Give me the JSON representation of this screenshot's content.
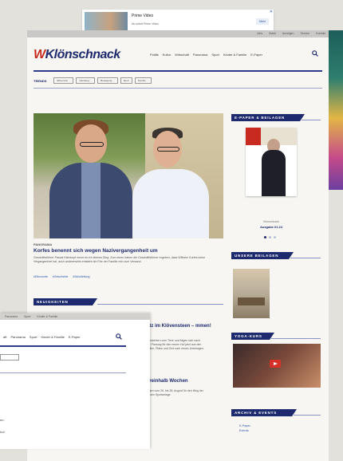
{
  "ad": {
    "title": "Prime Video",
    "subtitle": "Ab sofort Prime Video",
    "button": "Mehr",
    "close": "✕"
  },
  "topbar": [
    "Jobs",
    "Markt",
    "Anzeigen",
    "Service",
    "Kontakt"
  ],
  "logo": {
    "w": "W",
    "text": "Klönschnack"
  },
  "menu": [
    "Politik",
    "Kultur",
    "Wirtschaft",
    "Panorama",
    "Sport",
    "Kinder & Familie",
    "E-Paper"
  ],
  "trends": {
    "label": "TRENDS",
    "chips": [
      "Elbvororte ...",
      "Hamburg ...",
      "Bewegung ...",
      "Sport",
      "Familie ..."
    ]
  },
  "hero": {
    "kicker": "PANORAMA",
    "headline": "Korfes benennt sich wegen Naziver­gangenheit um",
    "teaser": "Geschäftsführer Pascal Kleinkopf nennt es ein kleines Ding: Zum einen haben die Geschäftsführer ergeben, dass Wilhelm Korfes keine Vergangenheit hat, auch andererseits entsteht die Ehe der Familie rein zum Versand.",
    "tags": [
      "#Elbvororte",
      "#Geschichte",
      "#Schulleitung"
    ]
  },
  "sections": {
    "epaper": "E-PAPER & BEILAGEN",
    "beilagen": "UNSERE BEILAGEN",
    "neuigkeiten": "NEUIGKEITEN",
    "yoga": "YOGA-KURS",
    "archiv": "ARCHIV & EVENTS"
  },
  "epaper": {
    "caption_small": "Klönschnack",
    "caption_issue": "Ausgabe 01.24"
  },
  "mid": {
    "title1": "atz im Klövensteen – mmen!",
    "text1": "wandertern vom Tiere und folgen sich nach die Planung für den neuen Hof jetzt aus den Teilen, Pläne und Zeit noch neues Unterlagen.",
    "title2": "ereinhalb Wochen",
    "text2": "ingen vom 26. bis 28. August für den Weg der neuen Sportanlage."
  },
  "archive": [
    "E-Paper",
    "Events"
  ],
  "overlay": {
    "topbar": [
      "Panorama",
      "Sport",
      "Kinder & Familie"
    ],
    "menu": [
      "aft",
      "Panorama",
      "Sport",
      "Kinder & Familie",
      "E-Paper"
    ],
    "fragments": [
      "en:",
      "hof"
    ]
  },
  "colors": {
    "brand_blue": "#1e2a6e",
    "brand_red": "#c92a20"
  }
}
